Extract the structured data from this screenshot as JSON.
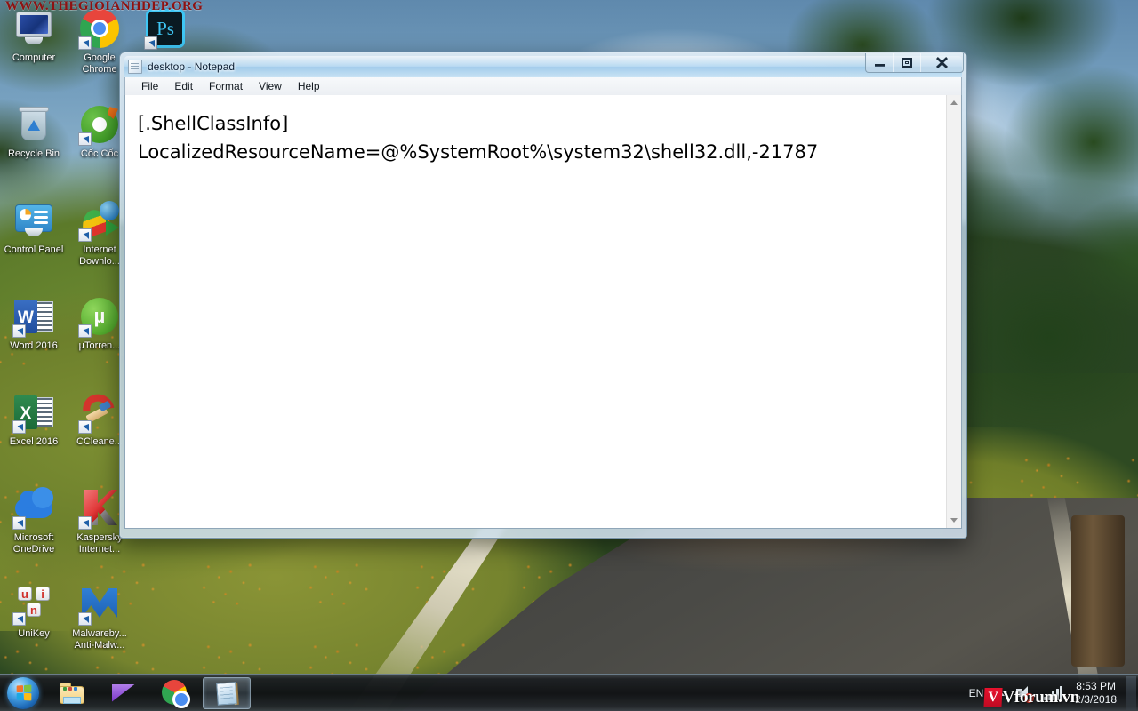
{
  "watermarks": {
    "top": "WWW.THEGIOIANHDEP.ORG",
    "tray_mark": "V",
    "tray_text": "Vforum.vn"
  },
  "desktop": {
    "icons": [
      {
        "name": "computer",
        "label": "Computer",
        "shortcut": false
      },
      {
        "name": "recycle-bin",
        "label": "Recycle Bin",
        "shortcut": false
      },
      {
        "name": "control-panel",
        "label": "Control Panel",
        "shortcut": false
      },
      {
        "name": "word-2016",
        "label": "Word 2016",
        "shortcut": true
      },
      {
        "name": "excel-2016",
        "label": "Excel 2016",
        "shortcut": true
      },
      {
        "name": "microsoft-onedrive",
        "label": "Microsoft OneDrive",
        "shortcut": true
      },
      {
        "name": "unikey",
        "label": "UniKey",
        "shortcut": true
      },
      {
        "name": "google-chrome",
        "label": "Google Chrome",
        "shortcut": true
      },
      {
        "name": "coc-coc",
        "label": "Cốc Cốc",
        "shortcut": true
      },
      {
        "name": "internet-download-manager",
        "label": "Internet Downlo...",
        "shortcut": true
      },
      {
        "name": "utorrent",
        "label": "µTorren...",
        "shortcut": true
      },
      {
        "name": "ccleaner",
        "label": "CCleane...",
        "shortcut": true
      },
      {
        "name": "kaspersky",
        "label": "Kaspersky Internet...",
        "shortcut": true
      },
      {
        "name": "malwarebytes",
        "label": "Malwareby... Anti-Malw...",
        "shortcut": true
      },
      {
        "name": "photoshop",
        "label": "",
        "shortcut": true
      }
    ],
    "icon_labels": {
      "computer": "Computer",
      "recycle_bin": "Recycle Bin",
      "control_panel": "Control Panel",
      "word": "Word 2016",
      "excel": "Excel 2016",
      "onedrive": "Microsoft OneDrive",
      "unikey": "UniKey",
      "chrome": "Google Chrome",
      "coccoc": "Cốc Cốc",
      "idm": "Internet Downlo...",
      "utorrent": "µTorren...",
      "ccleaner": "CCleane...",
      "kaspersky": "Kaspersky Internet...",
      "malwarebytes": "Malwareby... Anti-Malw..."
    }
  },
  "notepad": {
    "title": "desktop - Notepad",
    "menus": [
      {
        "label": "File"
      },
      {
        "label": "Edit"
      },
      {
        "label": "Format"
      },
      {
        "label": "View"
      },
      {
        "label": "Help"
      }
    ],
    "menu_labels": {
      "file": "File",
      "edit": "Edit",
      "format": "Format",
      "view": "View",
      "help": "Help"
    },
    "content": "[.ShellClassInfo]\nLocalizedResourceName=@%SystemRoot%\\system32\\shell32.dll,-21787",
    "controls": {
      "minimize": "Minimize",
      "maximize": "Maximize",
      "close": "Close"
    }
  },
  "taskbar": {
    "start_label": "Start",
    "buttons": [
      {
        "name": "windows-explorer",
        "label": "Windows Explorer",
        "active": false
      },
      {
        "name": "windows-media-player",
        "label": "Windows Media Player",
        "active": false
      },
      {
        "name": "google-chrome",
        "label": "Google Chrome",
        "active": false
      },
      {
        "name": "notepad",
        "label": "desktop - Notepad",
        "active": true
      }
    ],
    "tray": {
      "language": "EN",
      "volume": "Volume (muted)",
      "network": "Network",
      "time": "8:53 PM",
      "date": "2/3/2018",
      "show_desktop": "Show desktop"
    }
  },
  "colors": {
    "accent": "#4aa6e8",
    "taskbar": "#16181a",
    "window_frame": "#b2c8d8",
    "text": "#000000",
    "mute_red": "#e03b2f"
  }
}
